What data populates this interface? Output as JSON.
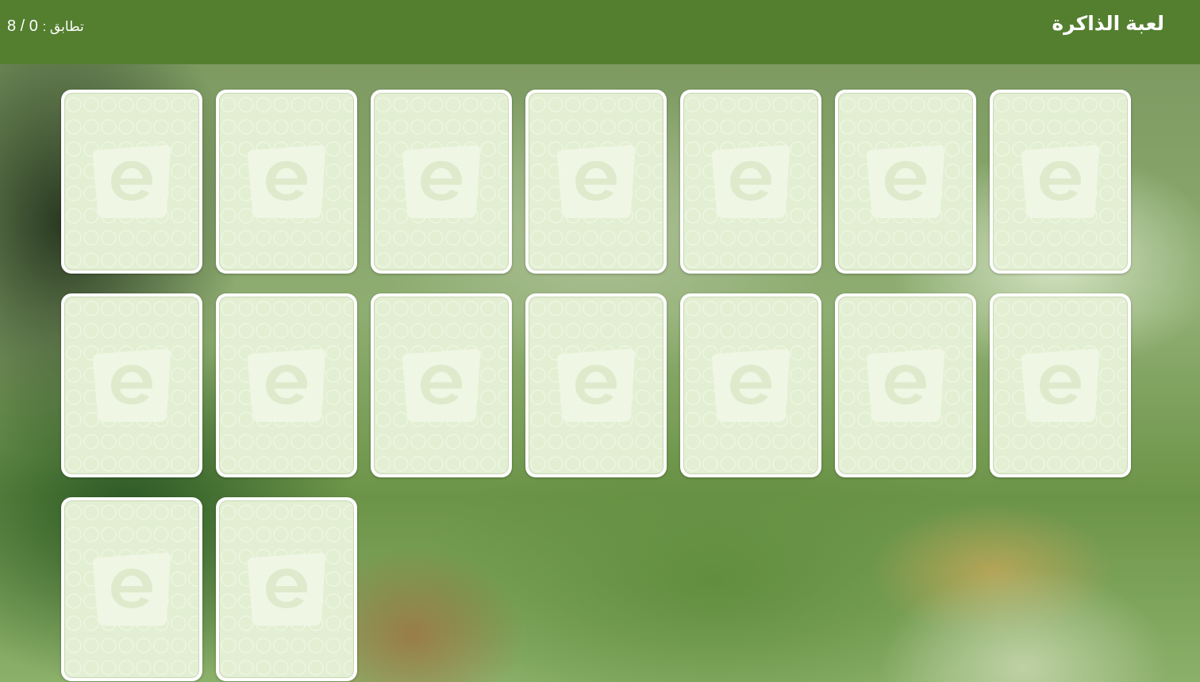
{
  "header": {
    "title": "لعبة الذاكرة",
    "score_label": "تطابق :",
    "score_value": "0 / 8"
  },
  "board": {
    "cards": [
      {
        "state": "face-down",
        "icon": "e-logo-icon"
      },
      {
        "state": "face-down",
        "icon": "e-logo-icon"
      },
      {
        "state": "face-down",
        "icon": "e-logo-icon"
      },
      {
        "state": "face-down",
        "icon": "e-logo-icon"
      },
      {
        "state": "face-down",
        "icon": "e-logo-icon"
      },
      {
        "state": "face-down",
        "icon": "e-logo-icon"
      },
      {
        "state": "face-down",
        "icon": "e-logo-icon"
      },
      {
        "state": "face-down",
        "icon": "e-logo-icon"
      },
      {
        "state": "face-down",
        "icon": "e-logo-icon"
      },
      {
        "state": "face-down",
        "icon": "e-logo-icon"
      },
      {
        "state": "face-down",
        "icon": "e-logo-icon"
      },
      {
        "state": "face-down",
        "icon": "e-logo-icon"
      },
      {
        "state": "face-down",
        "icon": "e-logo-icon"
      },
      {
        "state": "face-down",
        "icon": "e-logo-icon"
      },
      {
        "state": "face-down",
        "icon": "e-logo-icon"
      },
      {
        "state": "face-down",
        "icon": "e-logo-icon"
      }
    ]
  },
  "colors": {
    "header": "#537f2f",
    "card_border": "#ffffff",
    "card_back": "#e3efd2",
    "logo": "#f1f7e8"
  }
}
